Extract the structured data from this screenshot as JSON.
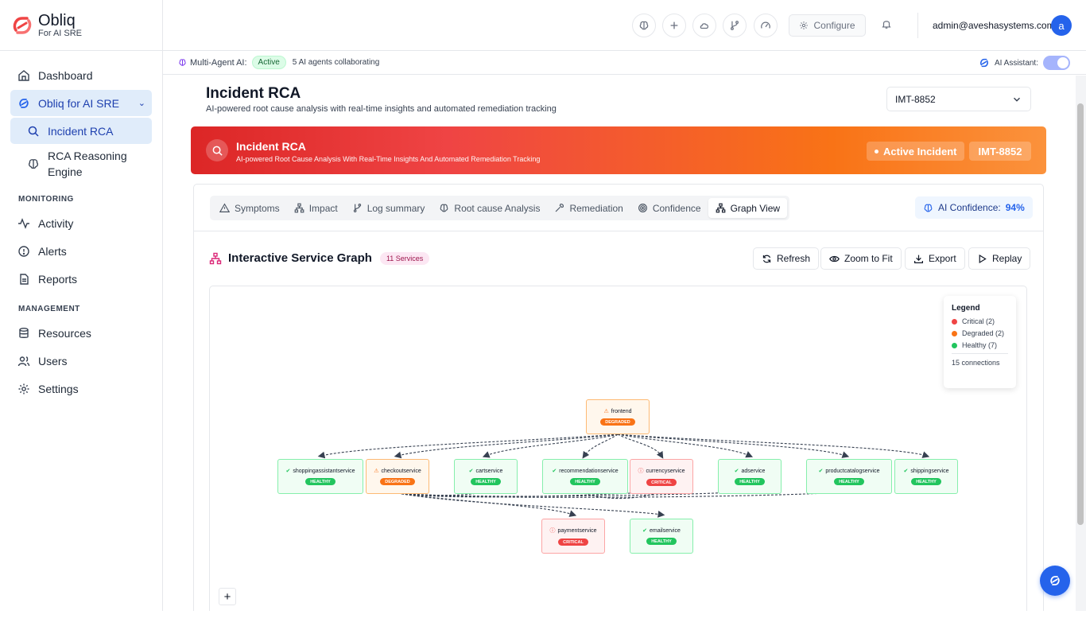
{
  "brand": {
    "name": "Obliq",
    "tagline": "For AI SRE"
  },
  "sidebar": {
    "items": [
      {
        "label": "Dashboard"
      },
      {
        "label": "Obliq for AI SRE"
      },
      {
        "label": "Incident RCA"
      },
      {
        "label": "RCA Reasoning Engine"
      }
    ],
    "monitoring_title": "MONITORING",
    "monitoring": [
      {
        "label": "Activity"
      },
      {
        "label": "Alerts"
      },
      {
        "label": "Reports"
      }
    ],
    "management_title": "MANAGEMENT",
    "management": [
      {
        "label": "Resources"
      },
      {
        "label": "Users"
      },
      {
        "label": "Settings"
      }
    ]
  },
  "topbar": {
    "configure_label": "Configure",
    "user_email": "admin@aveshasystems.com",
    "avatar_initial": "a"
  },
  "agentbar": {
    "label": "Multi-Agent AI:",
    "status": "Active",
    "collab": "5 AI agents collaborating",
    "assistant_label": "AI Assistant:"
  },
  "page": {
    "title": "Incident RCA",
    "subtitle": "AI-powered root cause analysis with real-time insights and automated remediation tracking",
    "selected_incident": "IMT-8852"
  },
  "banner": {
    "title": "Incident RCA",
    "subtitle": "AI-powered Root Cause Analysis With Real-Time Insights And Automated Remediation Tracking",
    "status": "Active Incident",
    "incident_id": "IMT-8852"
  },
  "tabs": [
    {
      "label": "Symptoms"
    },
    {
      "label": "Impact"
    },
    {
      "label": "Log summary"
    },
    {
      "label": "Root cause Analysis"
    },
    {
      "label": "Remediation"
    },
    {
      "label": "Confidence"
    },
    {
      "label": "Graph View"
    }
  ],
  "ai_confidence": {
    "label": "AI Confidence:",
    "value": "94%"
  },
  "graph": {
    "title": "Interactive Service Graph",
    "services_count": "11 Services",
    "buttons": {
      "refresh": "Refresh",
      "zoom": "Zoom to Fit",
      "export": "Export",
      "replay": "Replay"
    },
    "legend": {
      "title": "Legend",
      "critical": "Critical (2)",
      "degraded": "Degraded (2)",
      "healthy": "Healthy (7)",
      "connections": "15 connections"
    },
    "nodes": [
      {
        "name": "frontend",
        "status": "DEGRADED"
      },
      {
        "name": "shoppingassistantservice",
        "status": "HEALTHY"
      },
      {
        "name": "checkoutservice",
        "status": "DEGRADED"
      },
      {
        "name": "cartservice",
        "status": "HEALTHY"
      },
      {
        "name": "recommendationservice",
        "status": "HEALTHY"
      },
      {
        "name": "currencyservice",
        "status": "CRITICAL"
      },
      {
        "name": "adservice",
        "status": "HEALTHY"
      },
      {
        "name": "productcatalogservice",
        "status": "HEALTHY"
      },
      {
        "name": "shippingservice",
        "status": "HEALTHY"
      },
      {
        "name": "paymentservice",
        "status": "CRITICAL"
      },
      {
        "name": "emailservice",
        "status": "HEALTHY"
      }
    ],
    "zoom_in_label": "+"
  },
  "colors": {
    "accent": "#2563eb",
    "critical": "#ef4444",
    "degraded": "#f97316",
    "healthy": "#22c55e"
  }
}
